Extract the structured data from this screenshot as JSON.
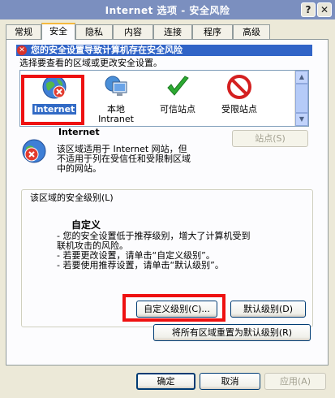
{
  "window": {
    "title": "Internet 选项 - 安全风险",
    "help_label": "?",
    "close_label": "✕"
  },
  "tabs": [
    {
      "label": "常规"
    },
    {
      "label": "安全"
    },
    {
      "label": "隐私"
    },
    {
      "label": "内容"
    },
    {
      "label": "连接"
    },
    {
      "label": "程序"
    },
    {
      "label": "高级"
    }
  ],
  "security": {
    "warning": "您的安全设置导致计算机存在安全风险",
    "instruction": "选择要查看的区域或更改安全设置。",
    "zones": [
      {
        "label": "Internet",
        "icon": "globe-icon",
        "selected": true
      },
      {
        "label": "本地\nIntranet",
        "icon": "monitor-icon",
        "selected": false
      },
      {
        "label": "可信站点",
        "icon": "checkmark-icon",
        "selected": false
      },
      {
        "label": "受限站点",
        "icon": "restricted-icon",
        "selected": false
      }
    ],
    "zone_name": "Internet",
    "zone_description": "该区域适用于 Internet 网站，但\n不适用于列在受信任和受限制区域\n中的网站。",
    "sites_button": "站点(S)",
    "level_group_title": "该区域的安全级别(L)",
    "level_name": "自定义",
    "level_description": "- 您的安全设置低于推荐级别，增大了计算机受到\n联机攻击的风险。\n- 若要更改设置，请单击“自定义级别”。\n- 若要使用推荐设置，请单击“默认级别”。",
    "custom_level_button": "自定义级别(C)...",
    "default_level_button": "默认级别(D)",
    "reset_all_button": "将所有区域重置为默认级别(R)"
  },
  "footer": {
    "ok_button": "确定",
    "cancel_button": "取消",
    "apply_button": "应用(A)"
  },
  "colors": {
    "highlight_red": "#EE1111",
    "selection_blue": "#316AC5",
    "warning_bar": "#3164C7"
  }
}
